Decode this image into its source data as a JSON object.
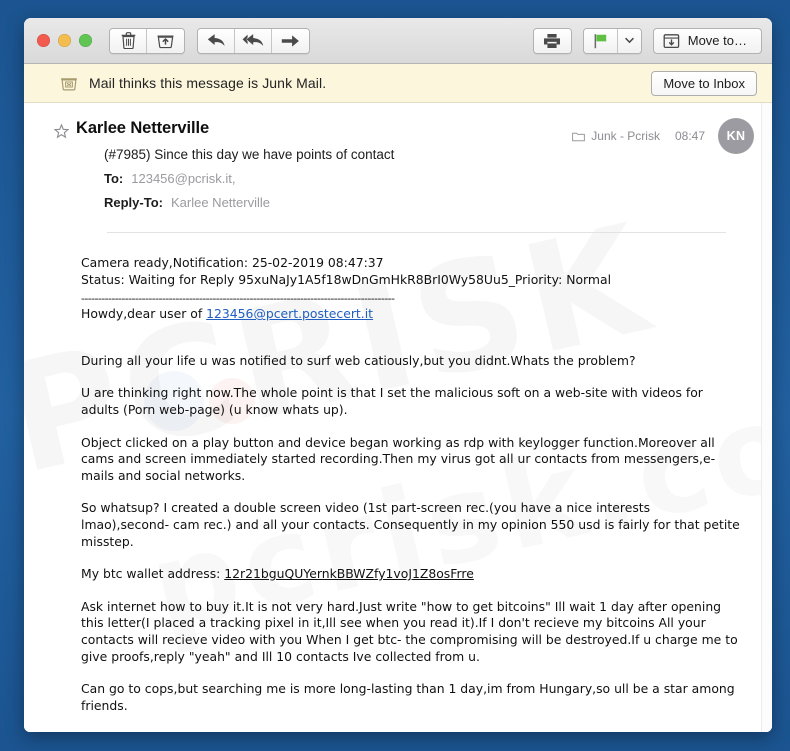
{
  "window": {
    "traffic_lights": [
      "close",
      "minimize",
      "maximize"
    ],
    "colors": {
      "desktop_blue": "#1c578f",
      "junk_banner": "#fcf6dc",
      "toolbar": "#e2e2e2",
      "link_blue": "#1f5fbf",
      "flag_green": "#5fc044",
      "avatar_gray": "#9b9ba1"
    }
  },
  "toolbar": {
    "buttons": [
      {
        "name": "delete-button",
        "icon": "trash-icon"
      },
      {
        "name": "junk-button",
        "icon": "junk-box-icon"
      },
      {
        "name": "reply-button",
        "icon": "reply-arrow-icon"
      },
      {
        "name": "reply-all-button",
        "icon": "reply-all-arrow-icon"
      },
      {
        "name": "forward-button",
        "icon": "forward-arrow-icon"
      }
    ],
    "print_icon": "printer-icon",
    "flag_icon": "flag-icon",
    "flag_dropdown_icon": "chevron-down-icon",
    "move_to_icon": "move-to-folder-icon",
    "move_to_label": "Move to…"
  },
  "junk_banner": {
    "icon": "junk-box-icon",
    "message": "Mail thinks this message is Junk Mail.",
    "action_label": "Move to Inbox"
  },
  "message": {
    "star_icon": "star-outline-icon",
    "sender": "Karlee Netterville",
    "subject": "(#7985) Since this day we have points of contact",
    "to_label": "To:",
    "to_value": "123456@pcrisk.it,",
    "reply_to_label": "Reply-To:",
    "reply_to_value": "Karlee Netterville",
    "mailbox_icon": "folder-icon",
    "mailbox": "Junk - Pcrisk",
    "time": "08:47",
    "avatar_initials": "KN"
  },
  "body": {
    "meta_line_1": "Camera ready,Notification: 25-02-2019 08:47:37",
    "meta_line_2": "Status: Waiting for Reply 95xuNaJy1A5f18wDnGmHkR8BrI0Wy58Uu5_Priority: Normal",
    "divider": "---------------------------------------------------------------------------------------------",
    "greeting_prefix": "Howdy,dear user of ",
    "greeting_email": "123456@pcert.postecert.it",
    "paragraph_1": "During all your life u was notified to surf web catiously,but you didnt.Whats the problem?",
    "paragraph_2": "U are thinking right now.The whole point is that I set the malicious soft on a web-site with videos for adults (Porn web-page) (u know whats up).",
    "paragraph_3": "Object clicked on a play button and device began working as rdp with keylogger function.Moreover all cams and screen immediately started recording.Then my virus got all ur contacts from messengers,e-mails and social networks.",
    "paragraph_4": "So whatsup? I created a double screen video (1st part-screen rec.(you have a nice interests lmao),second- cam rec.) and all your contacts. Consequently in my opinion 550 usd is fairly for that petite misstep.",
    "wallet_prefix": "My btc wallet address: ",
    "wallet_address": "12r21bguQUYernkBBWZfy1voJ1Z8osFrre",
    "paragraph_5": "Ask internet how to buy it.It is not very hard.Just write \"how to get bitcoins\" Ill wait 1 day after opening this letter(I placed a tracking pixel in it,Ill see when you read it).If I don't recieve my bitcoins All your contacts will recieve video with you When I get btc- the compromising will be destroyed.If u charge me to give proofs,reply \"yeah\" and Ill 10 contacts Ive collected from u.",
    "paragraph_6": "Can go to cops,but searching me is more long-lasting than 1 day,im from Hungary,so ull be a star among friends."
  },
  "watermark": {
    "line_1": "PCRISK",
    "line_2": "pcrisk.com"
  }
}
